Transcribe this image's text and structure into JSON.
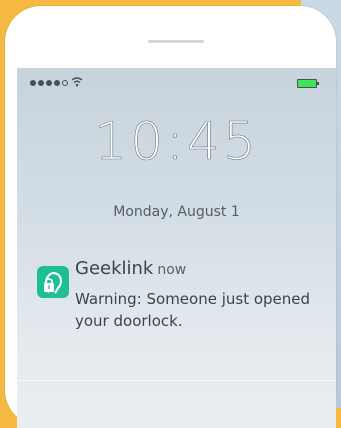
{
  "lock_screen": {
    "time": "10:45",
    "date": "Monday, August 1"
  },
  "status_bar": {
    "signal_icon": "signal-dots-icon",
    "wifi_icon": "wifi-icon",
    "battery_icon": "battery-icon",
    "battery_color": "#3ee55b"
  },
  "notification": {
    "app_name": "Geeklink",
    "when": "now",
    "message": "Warning: Someone just opened your doorlock.",
    "icon": "geeklink-lock-icon",
    "icon_color": "#1fbf96"
  },
  "colors": {
    "background": "#f5b942",
    "phone": "#ffffff"
  }
}
